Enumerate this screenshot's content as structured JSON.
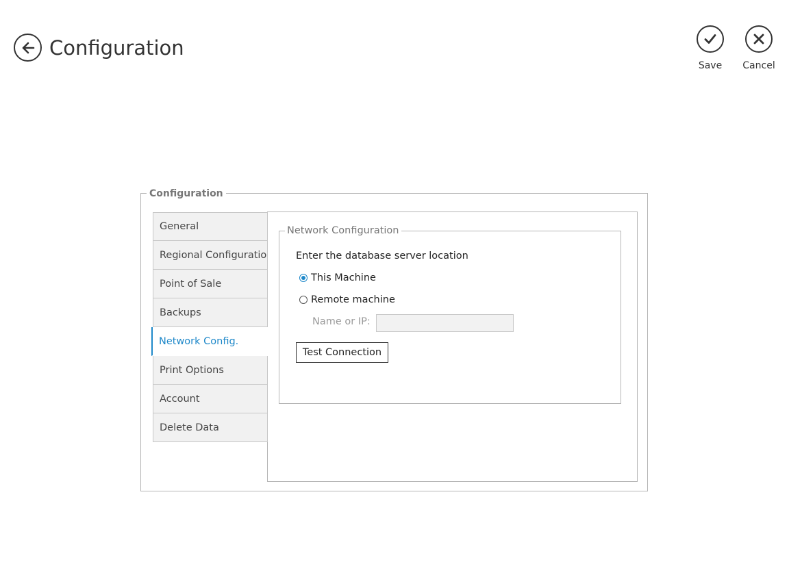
{
  "header": {
    "title": "Configuration",
    "back_icon": "back-arrow-icon"
  },
  "appbar": {
    "save_label": "Save",
    "cancel_label": "Cancel"
  },
  "config_group": {
    "legend": "Configuration",
    "tabs": [
      {
        "label": "General"
      },
      {
        "label": "Regional Configuration"
      },
      {
        "label": "Point of Sale"
      },
      {
        "label": "Backups"
      },
      {
        "label": "Network Config."
      },
      {
        "label": "Print Options"
      },
      {
        "label": "Account"
      },
      {
        "label": "Delete Data"
      }
    ],
    "active_tab": "Network Config."
  },
  "network": {
    "legend": "Network Configuration",
    "instruction": "Enter the database server location",
    "option_this_machine": "This Machine",
    "option_remote_machine": "Remote machine",
    "selected_option": "This Machine",
    "name_ip_label": "Name or IP:",
    "name_ip_value": "",
    "test_button": "Test Connection"
  },
  "colors": {
    "accent": "#1e88c9"
  }
}
